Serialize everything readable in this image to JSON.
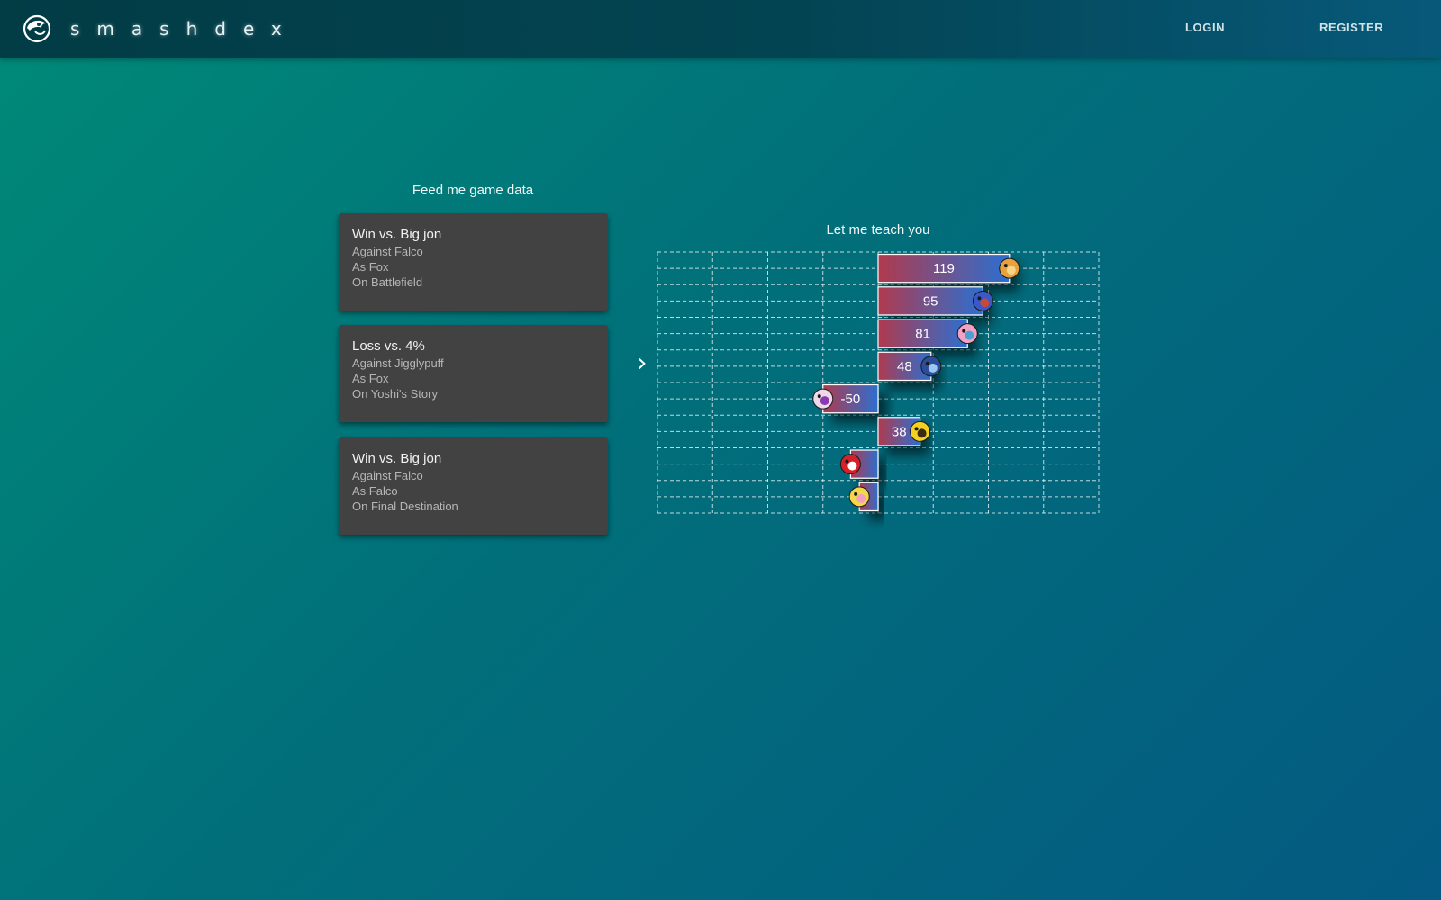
{
  "app": {
    "brand": "smashdex",
    "logo_icon": "chameleon-logo-icon"
  },
  "nav": {
    "login": "LOGIN",
    "register": "REGISTER"
  },
  "games": {
    "title": "Feed me game data",
    "items": [
      {
        "result": "Win vs. Big jon",
        "against": "Against Falco",
        "as": "As Fox",
        "stage": "On Battlefield"
      },
      {
        "result": "Loss vs. 4%",
        "against": "Against Jigglypuff",
        "as": "As Fox",
        "stage": "On Yoshi's Story"
      },
      {
        "result": "Win vs. Big jon",
        "against": "Against Falco",
        "as": "As Falco",
        "stage": "On Final Destination"
      }
    ]
  },
  "expand_icon": "chevron-right-icon",
  "chart_data": {
    "type": "bar",
    "orientation": "horizontal",
    "title": "Let me teach you",
    "xlim": [
      -200,
      200
    ],
    "grid": true,
    "bars": [
      {
        "character": "fox",
        "value": 119,
        "label": "119",
        "icon": "fox-stock-icon"
      },
      {
        "character": "falco",
        "value": 95,
        "label": "95",
        "icon": "falco-stock-icon"
      },
      {
        "character": "jigglypuff",
        "value": 81,
        "label": "81",
        "icon": "jigglypuff-stock-icon"
      },
      {
        "character": "marth",
        "value": 48,
        "label": "48",
        "icon": "marth-stock-icon"
      },
      {
        "character": "ice-climbers",
        "value": -50,
        "label": "-50",
        "icon": "ice-climbers-stock-icon"
      },
      {
        "character": "pikachu",
        "value": 38,
        "label": "38",
        "icon": "pikachu-stock-icon"
      },
      {
        "character": "mario",
        "value": -25,
        "label": "",
        "icon": "mario-stock-icon"
      },
      {
        "character": "peach",
        "value": -17,
        "label": "",
        "icon": "peach-stock-icon"
      }
    ],
    "colors": {
      "bar_start": "#b03a4e",
      "bar_end": "#2c6fd0",
      "grid": "#ffffff"
    }
  }
}
